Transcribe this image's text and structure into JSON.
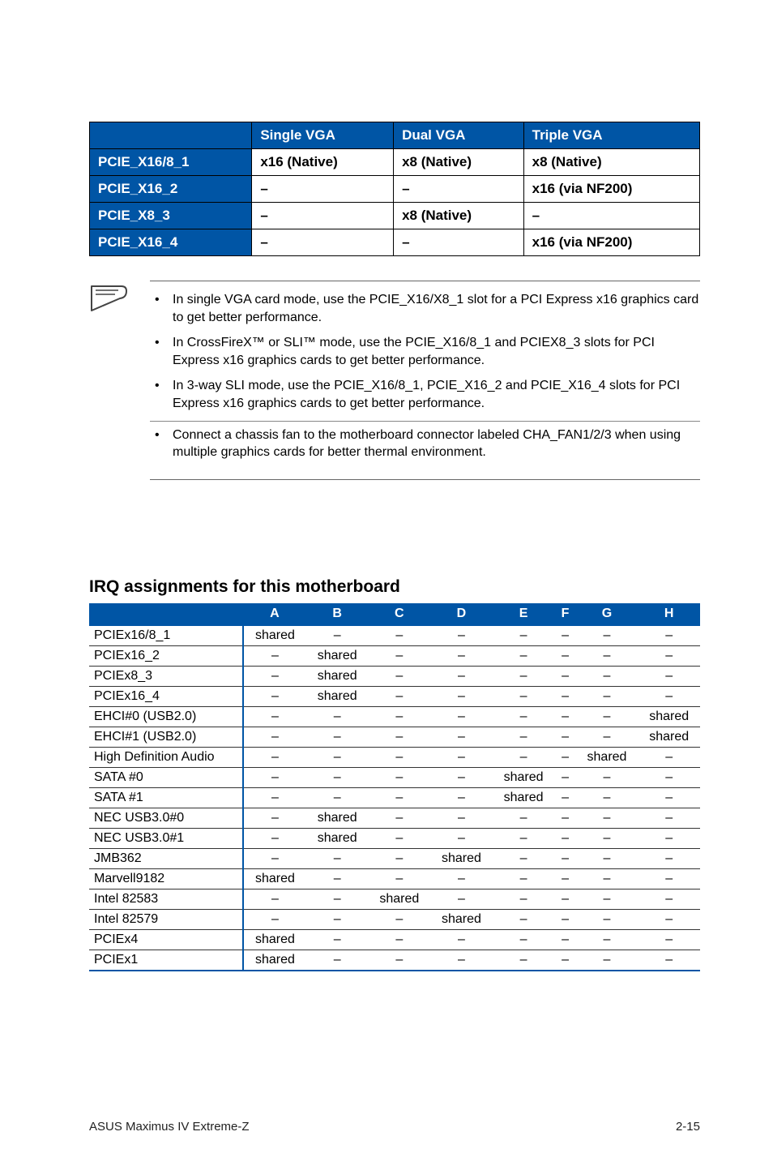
{
  "table1": {
    "headers": [
      "Single VGA",
      "Dual VGA",
      "Triple VGA"
    ],
    "rows": [
      {
        "label": "PCIE_X16/8_1",
        "cells": [
          "x16 (Native)",
          "x8 (Native)",
          "x8 (Native)"
        ]
      },
      {
        "label": "PCIE_X16_2",
        "cells": [
          "–",
          "–",
          "x16 (via NF200)"
        ]
      },
      {
        "label": "PCIE_X8_3",
        "cells": [
          "–",
          "x8 (Native)",
          "–"
        ]
      },
      {
        "label": "PCIE_X16_4",
        "cells": [
          "–",
          "–",
          "x16 (via NF200)"
        ]
      }
    ]
  },
  "notes_group1": [
    "In single VGA card mode, use the PCIE_X16/X8_1 slot for a PCI Express x16 graphics card to get better performance.",
    "In CrossFireX™ or SLI™ mode, use the PCIE_X16/8_1 and PCIEX8_3 slots for PCI Express x16 graphics cards to get better performance.",
    "In 3-way SLI mode, use the PCIE_X16/8_1, PCIE_X16_2 and PCIE_X16_4 slots for PCI Express x16 graphics cards to get better performance."
  ],
  "notes_group2": [
    "Connect a chassis fan to the motherboard connector labeled CHA_FAN1/2/3 when using multiple graphics cards for better thermal environment."
  ],
  "section_heading": "IRQ assignments for this motherboard",
  "table2": {
    "cols": [
      "A",
      "B",
      "C",
      "D",
      "E",
      "F",
      "G",
      "H"
    ],
    "rows": [
      {
        "label": "PCIEx16/8_1",
        "cells": [
          "shared",
          "–",
          "–",
          "–",
          "–",
          "–",
          "–",
          "–"
        ]
      },
      {
        "label": "PCIEx16_2",
        "cells": [
          "–",
          "shared",
          "–",
          "–",
          "–",
          "–",
          "–",
          "–"
        ]
      },
      {
        "label": "PCIEx8_3",
        "cells": [
          "–",
          "shared",
          "–",
          "–",
          "–",
          "–",
          "–",
          "–"
        ]
      },
      {
        "label": "PCIEx16_4",
        "cells": [
          "–",
          "shared",
          "–",
          "–",
          "–",
          "–",
          "–",
          "–"
        ]
      },
      {
        "label": "EHCI#0 (USB2.0)",
        "cells": [
          "–",
          "–",
          "–",
          "–",
          "–",
          "–",
          "–",
          "shared"
        ]
      },
      {
        "label": "EHCI#1 (USB2.0)",
        "cells": [
          "–",
          "–",
          "–",
          "–",
          "–",
          "–",
          "–",
          "shared"
        ]
      },
      {
        "label": "High Definition Audio",
        "cells": [
          "–",
          "–",
          "–",
          "–",
          "–",
          "–",
          "shared",
          "–"
        ]
      },
      {
        "label": "SATA #0",
        "cells": [
          "–",
          "–",
          "–",
          "–",
          "shared",
          "–",
          "–",
          "–"
        ]
      },
      {
        "label": "SATA #1",
        "cells": [
          "–",
          "–",
          "–",
          "–",
          "shared",
          "–",
          "–",
          "–"
        ]
      },
      {
        "label": "NEC USB3.0#0",
        "cells": [
          "–",
          "shared",
          "–",
          "–",
          "–",
          "–",
          "–",
          "–"
        ]
      },
      {
        "label": "NEC USB3.0#1",
        "cells": [
          "–",
          "shared",
          "–",
          "–",
          "–",
          "–",
          "–",
          "–"
        ]
      },
      {
        "label": "JMB362",
        "cells": [
          "–",
          "–",
          "–",
          "shared",
          "–",
          "–",
          "–",
          "–"
        ]
      },
      {
        "label": "Marvell9182",
        "cells": [
          "shared",
          "–",
          "–",
          "–",
          "–",
          "–",
          "–",
          "–"
        ]
      },
      {
        "label": "Intel 82583",
        "cells": [
          "–",
          "–",
          "shared",
          "–",
          "–",
          "–",
          "–",
          "–"
        ]
      },
      {
        "label": "Intel 82579",
        "cells": [
          "–",
          "–",
          "–",
          "shared",
          "–",
          "–",
          "–",
          "–"
        ]
      },
      {
        "label": "PCIEx4",
        "cells": [
          "shared",
          "–",
          "–",
          "–",
          "–",
          "–",
          "–",
          "–"
        ]
      },
      {
        "label": "PCIEx1",
        "cells": [
          "shared",
          "–",
          "–",
          "–",
          "–",
          "–",
          "–",
          "–"
        ]
      }
    ]
  },
  "footer_left": "ASUS Maximus IV Extreme-Z",
  "footer_right": "2-15",
  "bullet": "•"
}
